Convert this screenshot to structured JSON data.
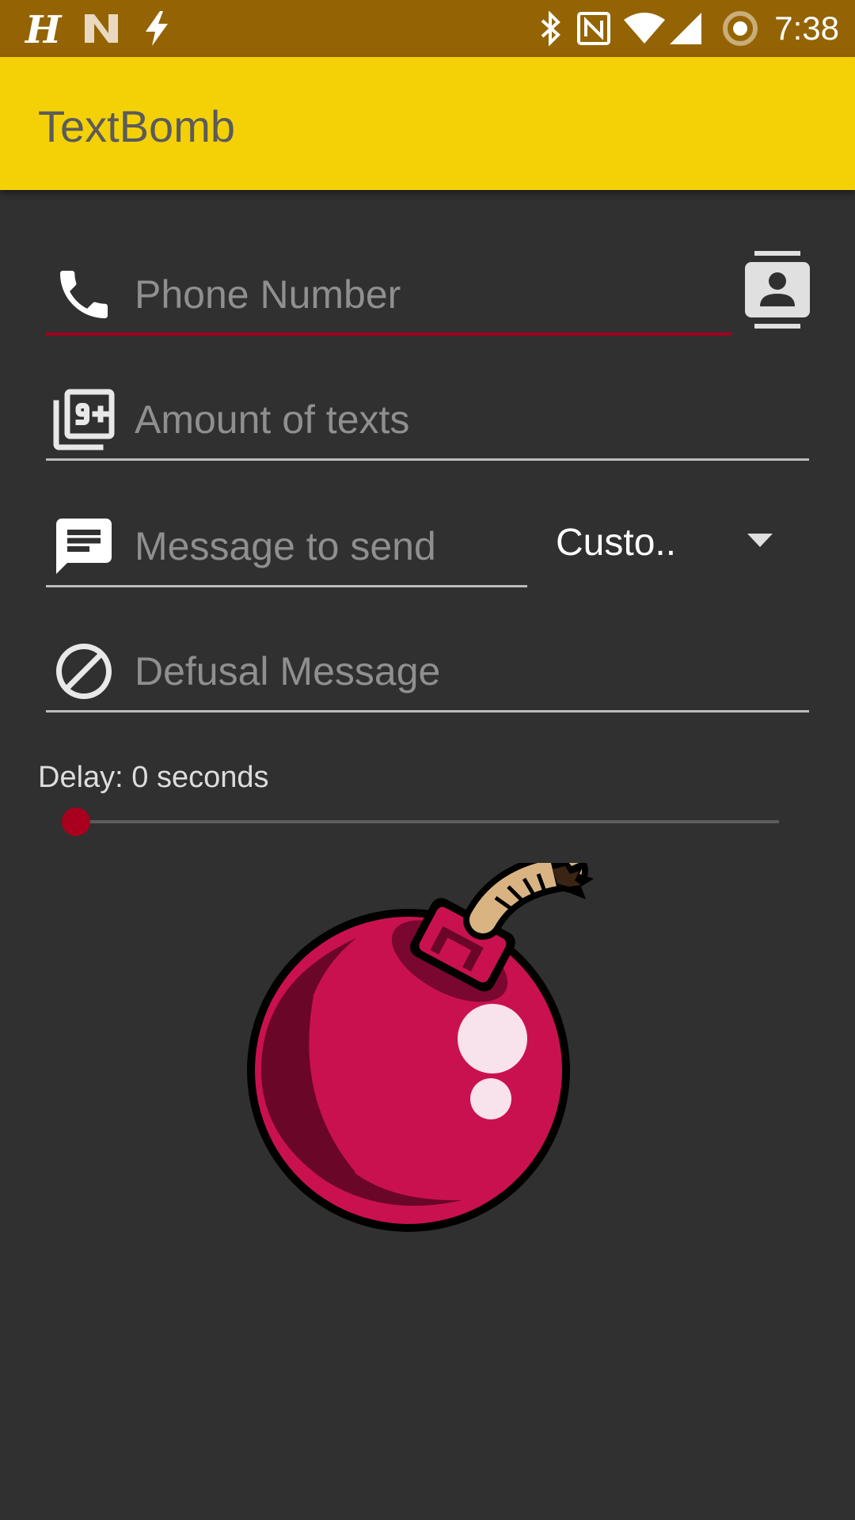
{
  "status_bar": {
    "time": "7:38",
    "left_icons": [
      "hangouts-icon",
      "nfc-app-icon",
      "flash-icon"
    ],
    "right_icons": [
      "bluetooth-icon",
      "nfc-icon",
      "wifi-icon",
      "signal-icon",
      "sync-icon"
    ]
  },
  "app_bar": {
    "title": "TextBomb",
    "color": "#f4d106"
  },
  "form": {
    "phone": {
      "placeholder": "Phone Number",
      "icon": "phone-icon",
      "focused": true
    },
    "contact_button_icon": "contact-book-icon",
    "amount": {
      "placeholder": "Amount of texts",
      "icon": "filter-9-plus-icon"
    },
    "message": {
      "placeholder": "Message to send",
      "icon": "message-icon"
    },
    "message_type": {
      "selected": "Custo.."
    },
    "defusal": {
      "placeholder": "Defusal Message",
      "icon": "block-icon"
    }
  },
  "delay": {
    "label": "Delay: 0 seconds",
    "value": 0
  },
  "colors": {
    "accent": "#a0001e",
    "background": "#303030",
    "status_bar": "#946404"
  },
  "bomb_button": {
    "icon": "bomb-icon"
  }
}
